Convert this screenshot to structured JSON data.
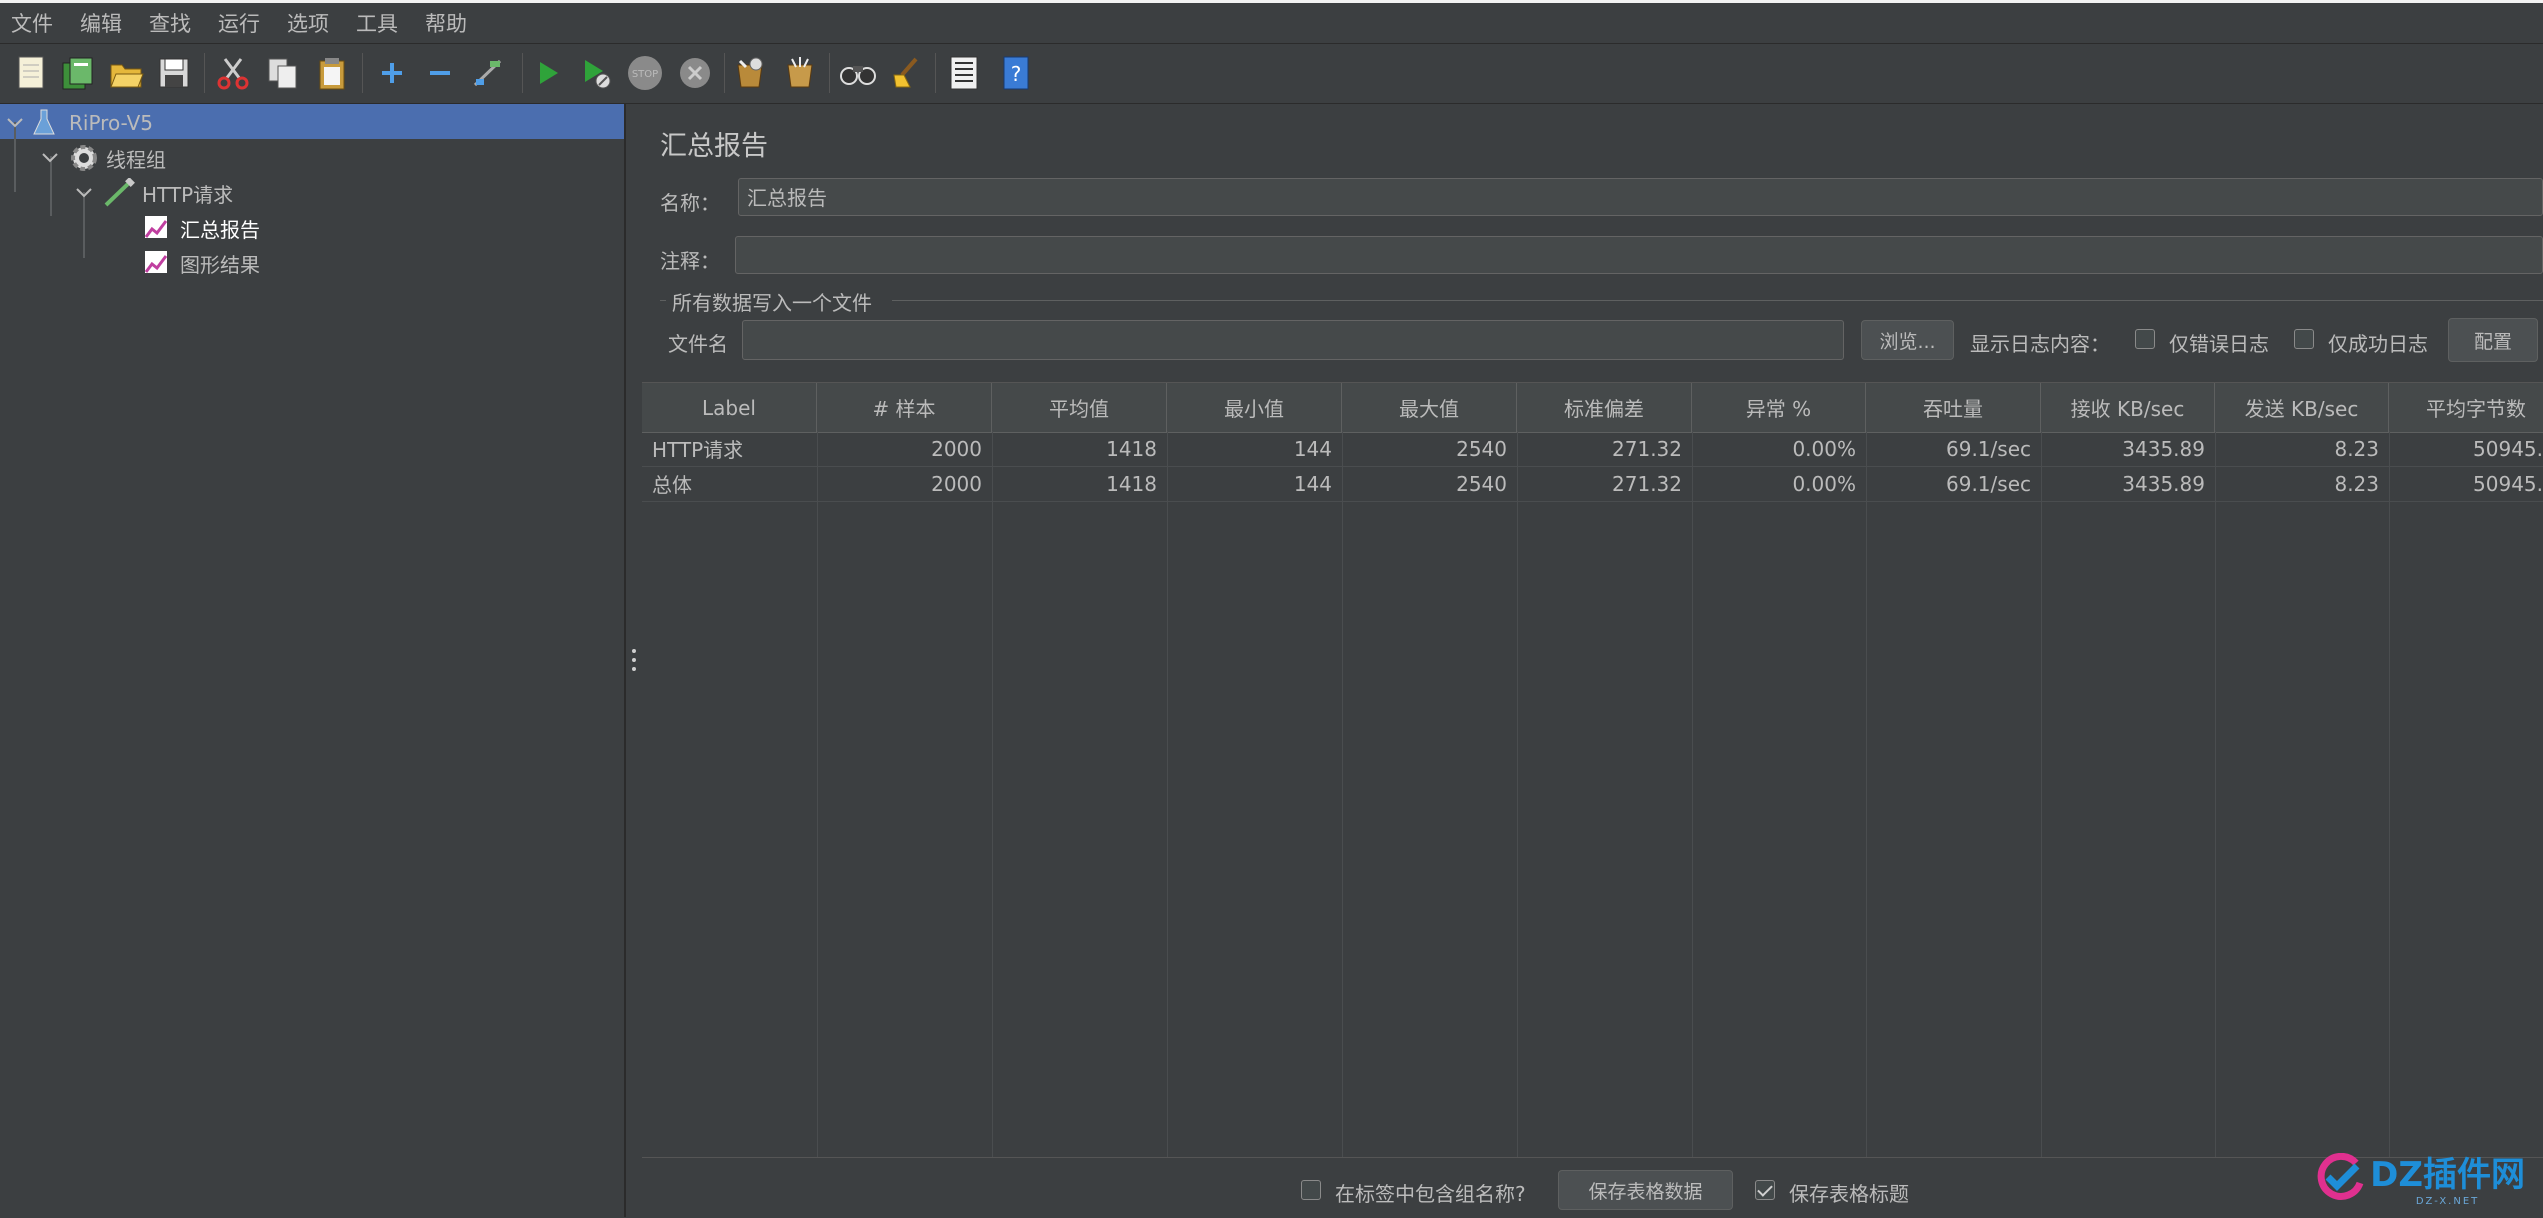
{
  "menu": [
    "文件",
    "编辑",
    "查找",
    "运行",
    "选项",
    "工具",
    "帮助"
  ],
  "toolbar_icons": [
    "new-icon",
    "templates-icon",
    "open-icon",
    "save-icon",
    "cut-icon",
    "copy-icon",
    "paste-icon",
    "expand-icon",
    "collapse-icon",
    "toggle-icon",
    "start-icon",
    "start-no-pause-icon",
    "stop-icon",
    "shutdown-icon",
    "clear-icon",
    "clear-all-icon",
    "search-icon",
    "reset-search-icon",
    "function-helper-icon",
    "help-icon"
  ],
  "tree": {
    "root": "RiPro-V5",
    "thread_group": "线程组",
    "http_request": "HTTP请求",
    "summary_report": "汇总报告",
    "graph_results": "图形结果"
  },
  "panel": {
    "title": "汇总报告",
    "name_label": "名称：",
    "name_value": "汇总报告",
    "comment_label": "注释：",
    "comment_value": "",
    "group_title": "所有数据写入一个文件",
    "filename_label": "文件名",
    "filename_value": "",
    "browse_button": "浏览...",
    "log_content_label": "显示日志内容：",
    "errors_only_label": "仅错误日志",
    "success_only_label": "仅成功日志",
    "configure_button": "配置"
  },
  "table": {
    "headers": [
      "Label",
      "# 样本",
      "平均值",
      "最小值",
      "最大值",
      "标准偏差",
      "异常 %",
      "吞吐量",
      "接收 KB/sec",
      "发送 KB/sec",
      "平均字节数"
    ],
    "rows": [
      [
        "HTTP请求",
        "2000",
        "1418",
        "144",
        "2540",
        "271.32",
        "0.00%",
        "69.1/sec",
        "3435.89",
        "8.23",
        "50945."
      ],
      [
        "总体",
        "2000",
        "1418",
        "144",
        "2540",
        "271.32",
        "0.00%",
        "69.1/sec",
        "3435.89",
        "8.23",
        "50945."
      ]
    ]
  },
  "bottom": {
    "include_group_label": "在标签中包含组名称?",
    "include_group_checked": false,
    "save_table_button": "保存表格数据",
    "save_header_label": "保存表格标题",
    "save_header_checked": true
  },
  "watermark": {
    "text": "DZ插件网",
    "sub": "DZ-X.NET"
  },
  "colors": {
    "background": "#3c3f41",
    "selection": "#4b6eaf",
    "text": "#bbbbbb",
    "field": "#45494a"
  }
}
